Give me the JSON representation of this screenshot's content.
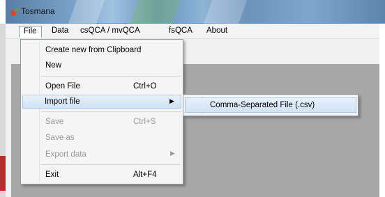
{
  "window": {
    "title": "Tosmana"
  },
  "menubar": {
    "items": [
      {
        "label": "File"
      },
      {
        "label": "Data"
      },
      {
        "label": "csQCA / mvQCA"
      },
      {
        "label": "fsQCA"
      },
      {
        "label": "About"
      }
    ]
  },
  "file_menu": {
    "create_from_clipboard": "Create new from Clipboard",
    "new": "New",
    "open_file": "Open File",
    "open_file_shortcut": "Ctrl+O",
    "import_file": "Import file",
    "save": "Save",
    "save_shortcut": "Ctrl+S",
    "save_as": "Save as",
    "export_data": "Export data",
    "exit": "Exit",
    "exit_shortcut": "Alt+F4"
  },
  "import_submenu": {
    "csv": "Comma-Separated File (.csv)"
  }
}
